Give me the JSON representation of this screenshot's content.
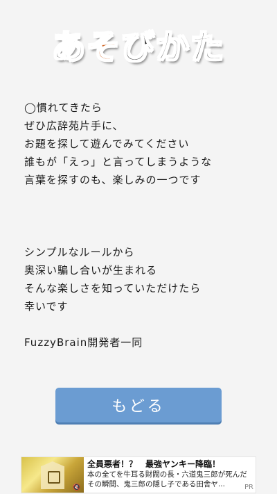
{
  "title": {
    "chars": [
      "あ",
      "そ",
      "び",
      "か",
      "た"
    ]
  },
  "content": {
    "paragraph1": [
      "◯慣れてきたら",
      "ぜひ広辞苑片手に、",
      "お題を探して遊んでみてください",
      "誰もが「えっ」と言ってしまうような",
      "言葉を探すのも、楽しみの一つです"
    ],
    "paragraph2": [
      "シンプルなルールから",
      "奥深い騙し合いが生まれる",
      "そんな楽しさを知っていただけたら",
      "幸いです"
    ],
    "signature": "FuzzyBrain開発者一同"
  },
  "back_button": {
    "label": "もどる"
  },
  "ad": {
    "title": "全員悪者！？　最強ヤンキー降臨！",
    "body_line1": "本の全てを牛耳る財閥の長・六道鬼三郎が死んだ",
    "body_line2": "その瞬間、鬼三郎の隠し子である田舎ヤ...",
    "pr_label": "PR",
    "mute_icon": "speaker-mute-icon"
  },
  "colors": {
    "background": "#f4f4f4",
    "title_dark": "#2a2a2a",
    "title_accent": "#d2692a",
    "button": "#6b9cd2"
  }
}
